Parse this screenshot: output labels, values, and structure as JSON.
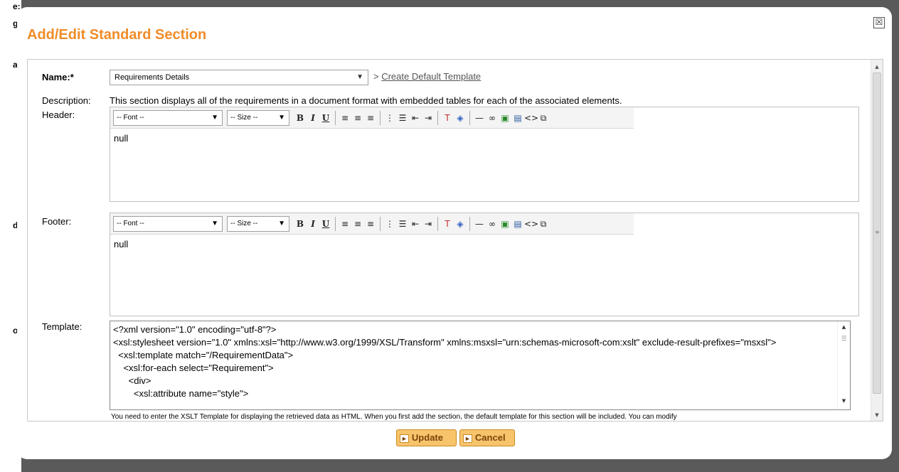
{
  "backdrop": {
    "fragments": [
      "e:",
      "gc",
      "at",
      "da",
      "or"
    ]
  },
  "dialog": {
    "title": "Add/Edit Standard Section",
    "close_symbol": "☒"
  },
  "form": {
    "name_label": "Name:*",
    "name_value": "Requirements Details",
    "create_prefix": ">",
    "create_link": "Create Default Template",
    "description_label": "Description:",
    "description_text": "This section displays all of the requirements in a document format with embedded tables for each of the associated elements.",
    "header_label": "Header:",
    "header_value": "null",
    "footer_label": "Footer:",
    "footer_value": "null",
    "template_label": "Template:",
    "template_value": "<?xml version=\"1.0\" encoding=\"utf-8\"?>\n<xsl:stylesheet version=\"1.0\" xmlns:xsl=\"http://www.w3.org/1999/XSL/Transform\" xmlns:msxsl=\"urn:schemas-microsoft-com:xslt\" exclude-result-prefixes=\"msxsl\">\n  <xsl:template match=\"/RequirementData\">\n    <xsl:for-each select=\"Requirement\">\n      <div>\n        <xsl:attribute name=\"style\">",
    "template_help": "You need to enter the XSLT Template for displaying the retrieved data as HTML. When you first add the section, the default template for this section will be included. You can modify"
  },
  "toolbar": {
    "font_select": "-- Font --",
    "size_select": "-- Size --",
    "bold": "B",
    "italic": "I",
    "underline": "U"
  },
  "buttons": {
    "update": "Update",
    "cancel": "Cancel"
  },
  "colors": {
    "title": "#f08c28",
    "button_bg": "#f7c46c",
    "button_text": "#7a4608"
  }
}
